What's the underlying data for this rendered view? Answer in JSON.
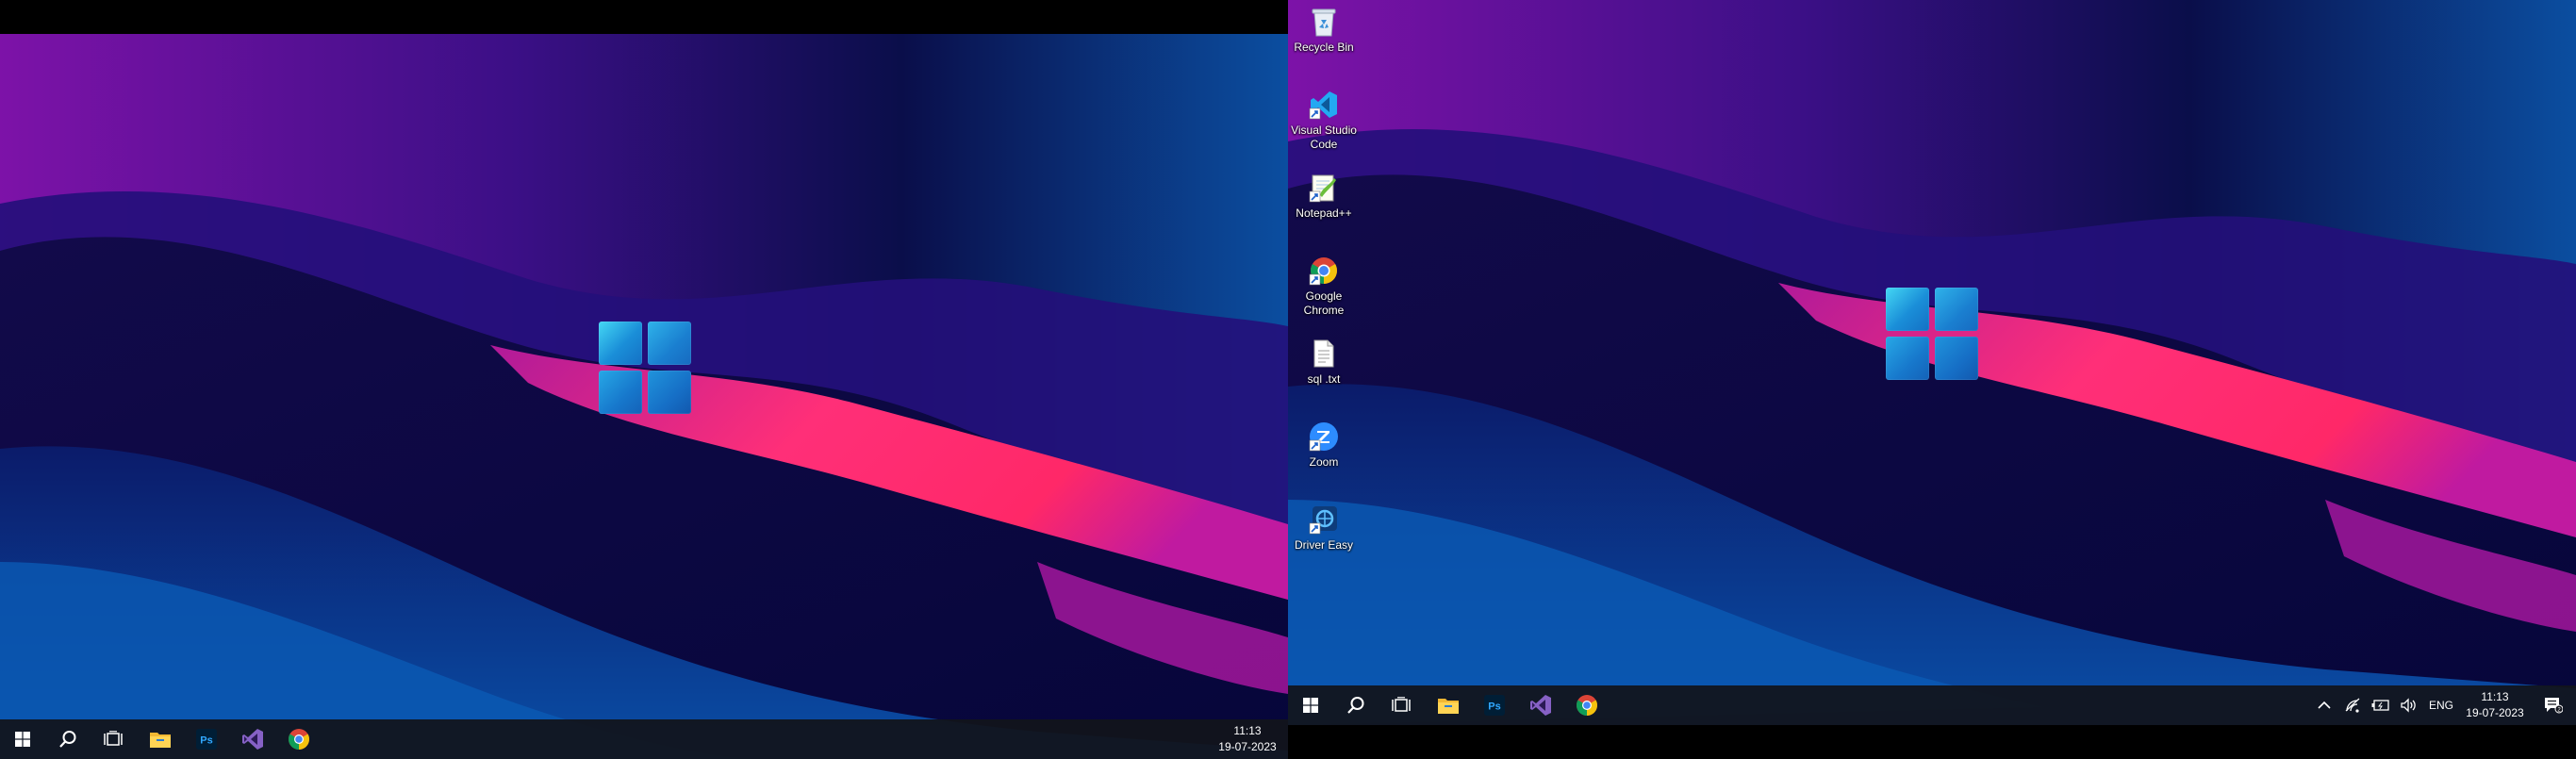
{
  "colors": {
    "taskbar": "#12141c",
    "ribbon": "#ff2f78",
    "wallpaper_top_left": "#7d1aa8",
    "wallpaper_top_right": "#0b4ea0"
  },
  "monitors": {
    "left": {
      "taskbar": {
        "start": "windows-icon",
        "search": "search-icon",
        "task_view": "task-view-icon",
        "apps": [
          "file-explorer-icon",
          "photoshop-icon",
          "visual-studio-icon",
          "chrome-icon"
        ],
        "photoshop_label": "Ps",
        "clock": {
          "time": "11:13",
          "date": "19-07-2023"
        }
      }
    },
    "right": {
      "desktop_icons": [
        {
          "label": "Recycle Bin",
          "icon": "recycle-bin-icon"
        },
        {
          "label": "Visual Studio Code",
          "icon": "vscode-icon"
        },
        {
          "label": "Notepad++",
          "icon": "notepad-plus-plus-icon"
        },
        {
          "label": "Google Chrome",
          "icon": "chrome-icon"
        },
        {
          "label": "sql .txt",
          "icon": "text-file-icon"
        },
        {
          "label": "Zoom",
          "icon": "zoom-icon"
        },
        {
          "label": "Driver Easy",
          "icon": "driver-easy-icon"
        }
      ],
      "taskbar": {
        "start": "windows-icon",
        "search": "search-icon",
        "task_view": "task-view-icon",
        "apps": [
          "file-explorer-icon",
          "photoshop-icon",
          "visual-studio-icon",
          "chrome-icon"
        ],
        "photoshop_label": "Ps",
        "tray": {
          "chevron": "chevron-up-icon",
          "network": "network-icon",
          "battery": "battery-icon",
          "volume": "volume-icon",
          "language": "ENG",
          "notifications": "notification-icon",
          "notification_count": "2"
        },
        "clock": {
          "time": "11:13",
          "date": "19-07-2023"
        }
      }
    }
  }
}
